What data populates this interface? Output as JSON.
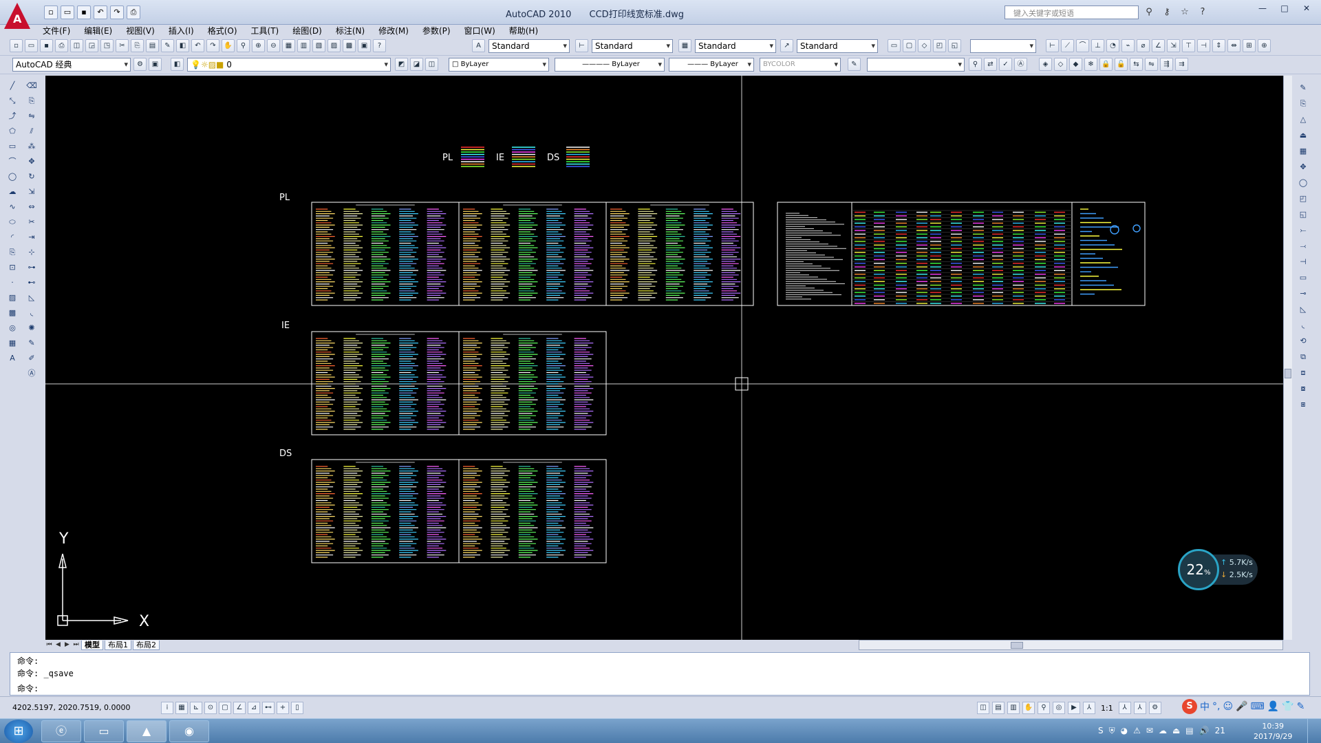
{
  "window": {
    "app_title": "AutoCAD 2010",
    "file_title": "CCD打印线宽标准.dwg",
    "search_placeholder": "键入关键字或短语",
    "minimize": "—",
    "restore": "□",
    "close": "✕"
  },
  "menu": [
    "文件(F)",
    "编辑(E)",
    "视图(V)",
    "插入(I)",
    "格式(O)",
    "工具(T)",
    "绘图(D)",
    "标注(N)",
    "修改(M)",
    "参数(P)",
    "窗口(W)",
    "帮助(H)"
  ],
  "toolbar_styles": {
    "text_style": "Standard",
    "dim_style": "Standard",
    "table_style": "Standard",
    "multileader_style": "Standard"
  },
  "toolbar_row2": {
    "workspace": "AutoCAD 经典",
    "layer": "0",
    "color": "ByLayer",
    "linetype": "ByLayer",
    "lineweight": "ByLayer",
    "plotstyle": "BYCOLOR"
  },
  "drawing": {
    "labels": [
      "PL",
      "IE",
      "DS"
    ],
    "ucs_x": "X",
    "ucs_y": "Y"
  },
  "layout_tabs": [
    "模型",
    "布局1",
    "布局2"
  ],
  "command_lines": [
    "命令:",
    "命令: _qsave",
    "命令:"
  ],
  "status": {
    "coordinates": "4202.5197, 2020.7519, 0.0000",
    "annotation_scale": "1:1"
  },
  "network_widget": {
    "percent": "22",
    "percent_unit": "%",
    "upload": "5.7K/s",
    "download": "2.5K/s"
  },
  "ime": {
    "logo": "S",
    "lang": "中"
  },
  "taskbar": {
    "time": "10:39",
    "date": "2017/9/29",
    "tray_num": "21"
  }
}
